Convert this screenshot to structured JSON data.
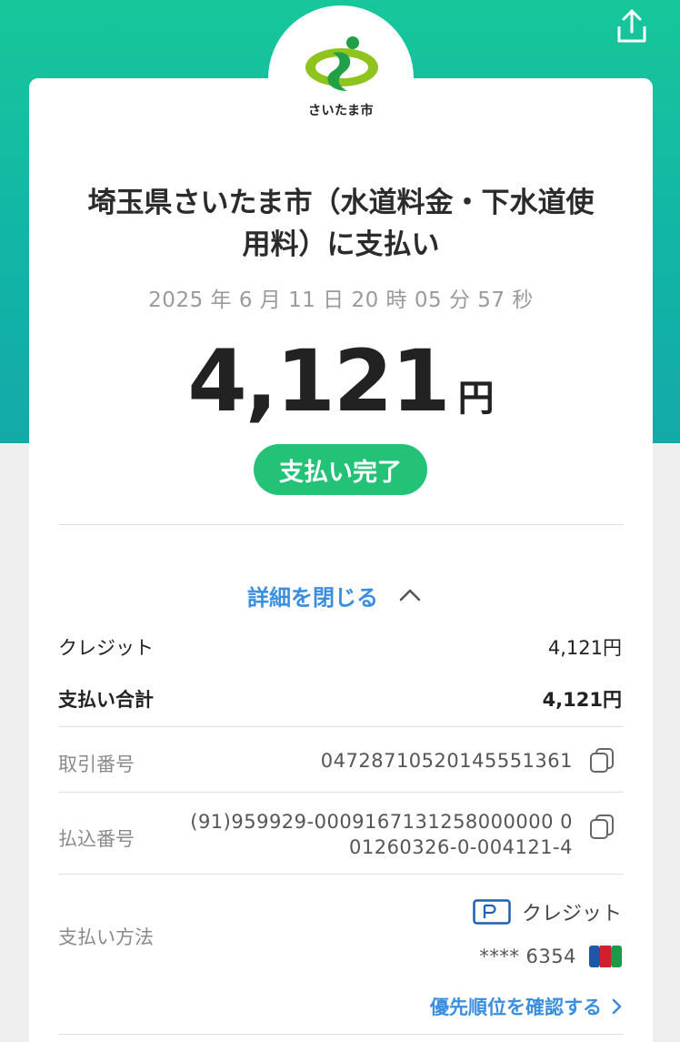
{
  "header": {
    "share_icon": "share-icon",
    "logo_text": "さいたま市",
    "brand_colors": {
      "primary": "#17c79a",
      "secondary": "#13aaa8"
    }
  },
  "payment": {
    "title": "埼玉県さいたま市（水道料金・下水道使用料）に支払い",
    "datetime": "2025 年 6 月 11 日 20 時 05 分 57 秒",
    "amount": "4,121",
    "currency": "円",
    "status": "支払い完了",
    "status_color": "#23c277"
  },
  "details": {
    "toggle_label": "詳細を閉じる",
    "credit_label": "クレジット",
    "credit_value": "4,121円",
    "total_label": "支払い合計",
    "total_value": "4,121円",
    "transaction_label": "取引番号",
    "transaction_value": "04728710520145551361",
    "payin_label": "払込番号",
    "payin_value_line1": "(91)959929-0009167131258000000 0",
    "payin_value_line2": "01260326-0-004121-4",
    "method_label": "支払い方法",
    "method_value": "クレジット",
    "card_number": "**** 6354",
    "card_brand": "JCB",
    "priority_link": "優先順位を確認する",
    "link_color": "#3a8ee0"
  }
}
